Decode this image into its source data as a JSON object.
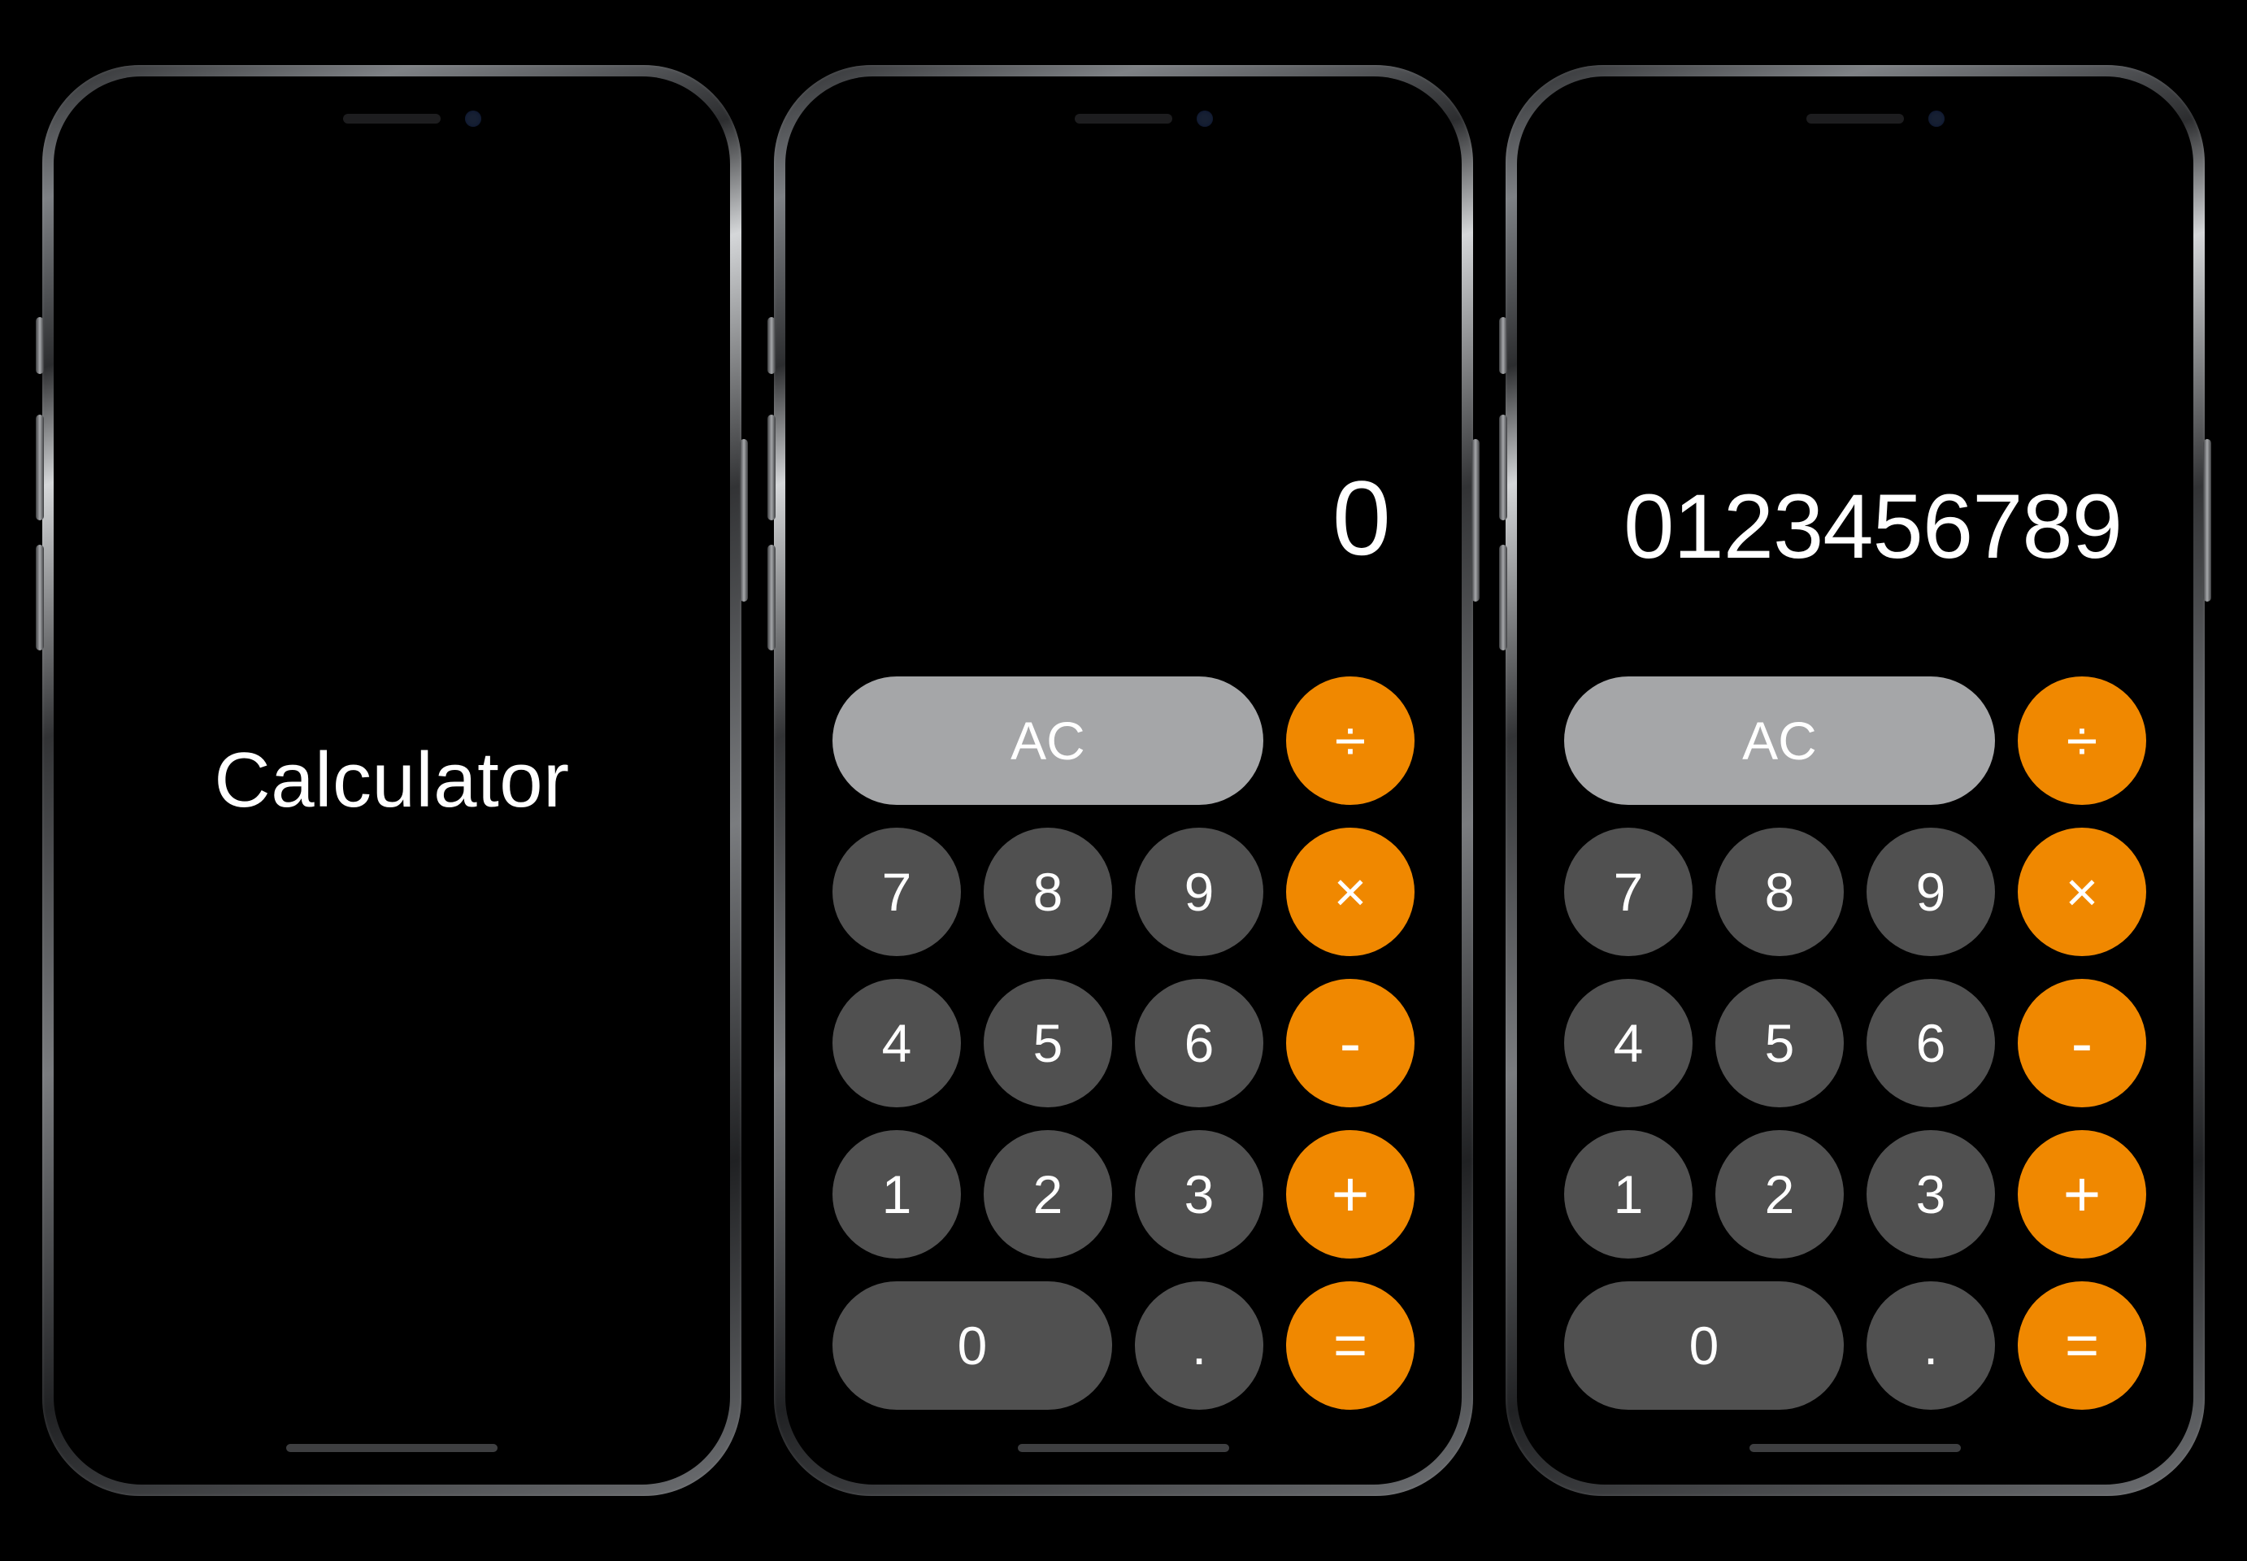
{
  "app_name": "Calculator",
  "colors": {
    "background": "#000000",
    "key_light": "#a5a6a8",
    "key_dark": "#505050",
    "key_op": "#f08800",
    "text": "#ffffff"
  },
  "phones": [
    {
      "id": "splash",
      "splash_title": "Calculator"
    },
    {
      "id": "calc-zero",
      "display": "0"
    },
    {
      "id": "calc-full",
      "display": "0123456789"
    }
  ],
  "keys": {
    "clear": "AC",
    "divide": "÷",
    "multiply": "×",
    "minus": "-",
    "plus": "+",
    "equals": "=",
    "decimal": ".",
    "d0": "0",
    "d1": "1",
    "d2": "2",
    "d3": "3",
    "d4": "4",
    "d5": "5",
    "d6": "6",
    "d7": "7",
    "d8": "8",
    "d9": "9"
  }
}
